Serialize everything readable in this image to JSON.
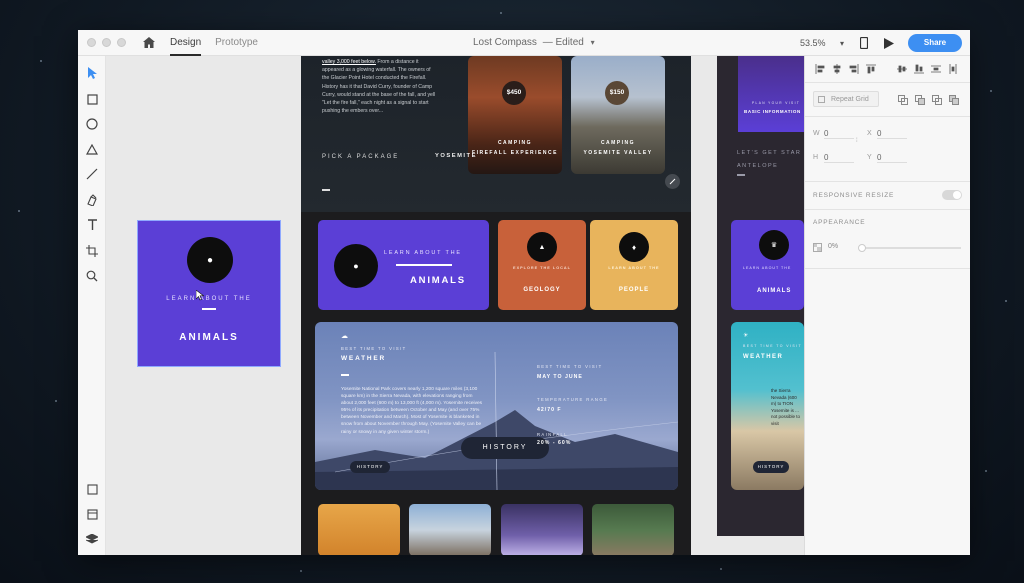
{
  "app": {
    "tabs": {
      "design": "Design",
      "prototype": "Prototype"
    },
    "document_title": "Lost Compass",
    "document_status": "— Edited",
    "zoom": "53.5%",
    "share_label": "Share"
  },
  "selected_tile": {
    "line1": "LEARN ABOUT THE",
    "line2": "ANIMALS"
  },
  "artboard": {
    "hero_text_prefix": "",
    "hero_link": "valley 3,000 feet below.",
    "hero_text": "From a distance it appeared as a glowing waterfall. The owners of the Glacier Point Hotel conducted the Firefall. History has it that David Curry, founder of Camp Curry, would stand at the base of the fall, and yell \"Let the fire fall,\" each night as a signal to start pushing the embers over...",
    "pick_package": "PICK A PACKAGE",
    "yosemite": "YOSEMITE",
    "package_1": {
      "price": "$450",
      "title": "CAMPING",
      "subtitle": "FIREFALL EXPERIENCE"
    },
    "package_2": {
      "price": "$150",
      "title": "CAMPING",
      "subtitle": "YOSEMITE VALLEY"
    },
    "animals": {
      "line1": "LEARN ABOUT THE",
      "line2": "ANIMALS"
    },
    "geology": {
      "line1": "EXPLORE THE LOCAL",
      "line2": "GEOLOGY"
    },
    "people": {
      "line1": "LEARN ABOUT THE",
      "line2": "PEOPLE"
    },
    "weather": {
      "kicker": "BEST TIME TO VISIT",
      "title": "WEATHER",
      "body": "Yosemite National Park covers nearly 1,200 square miles (3,100 square km) in the Sierra Nevada, with elevations ranging from about 2,000 feet (600 m) to 13,000 ft (4,000 m). Yosemite receives 95% of its precipitation between October and May (and over 75% between November and March). Most of Yosemite is blanketed in snow from about November through May. (Yosemite Valley can be rainy or snowy in any given winter storm.)",
      "history_small": "HISTORY",
      "history_big": "HISTORY",
      "best_label": "BEST TIME TO VISIT",
      "best_value": "MAY TO JUNE",
      "temp_label": "TEMPERATURE RANGE",
      "temp_value": "42/70 F",
      "rain_label": "RAINFALL",
      "rain_value": "20% - 60%"
    }
  },
  "side_board": {
    "kicker": "PLAN YOUR VISIT",
    "title": "BASIC INFORMATION",
    "lets_get": "LET'S GET STAR",
    "antelope": "ANTELOPE",
    "animals_line1": "LEARN ABOUT THE",
    "animals_line2": "ANIMALS",
    "weather_kicker": "BEST TIME TO VISIT",
    "weather_title": "WEATHER",
    "weather_body": "the Sierra Nevada (600 m) to TION Yosemite is ... not possible to visit",
    "history": "HISTORY"
  },
  "properties": {
    "repeat_grid": "Repeat Grid",
    "w_label": "W",
    "w_value": "0",
    "x_label": "X",
    "x_value": "0",
    "h_label": "H",
    "h_value": "0",
    "y_label": "Y",
    "y_value": "0",
    "responsive_resize": "RESPONSIVE RESIZE",
    "appearance": "APPEARANCE",
    "opacity": "0%"
  },
  "colors": {
    "accent": "#3d8ff2",
    "purple": "#5b3fd6",
    "geology": "#c8613a",
    "people": "#e8b45c"
  }
}
